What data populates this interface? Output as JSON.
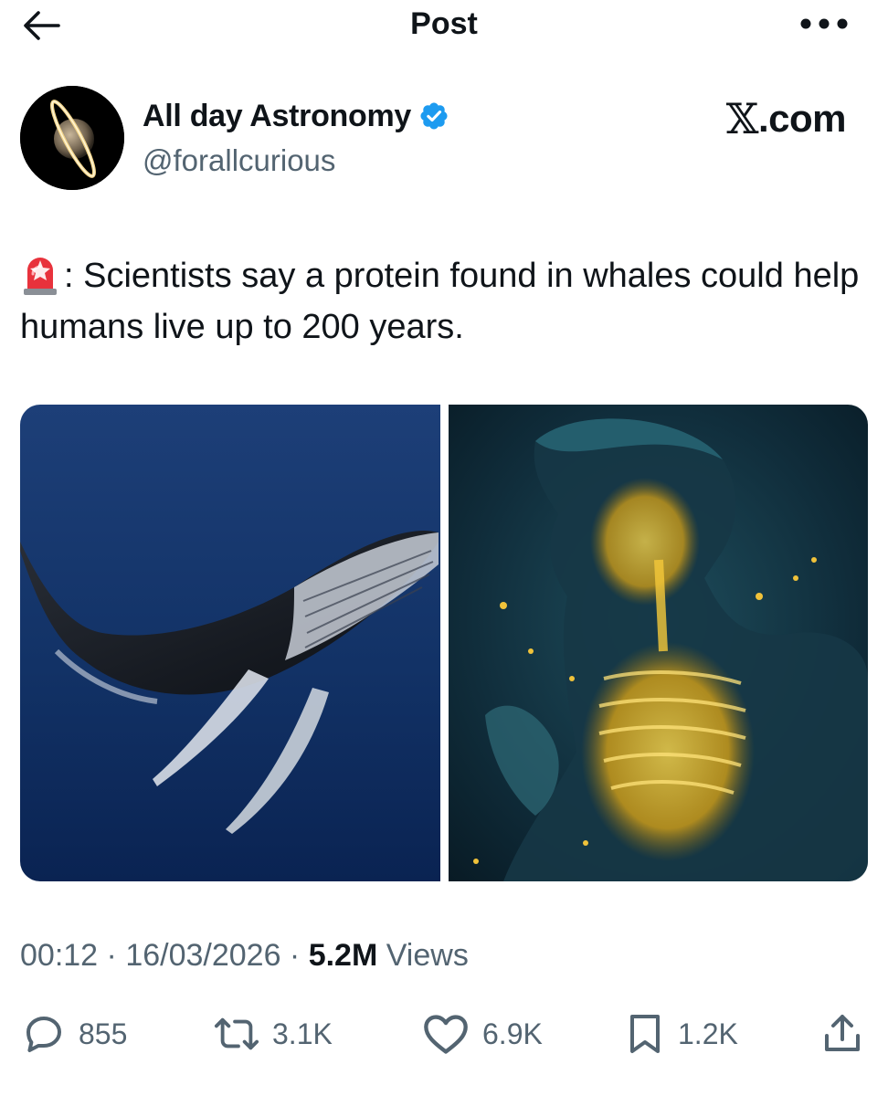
{
  "header": {
    "title": "Post",
    "back_icon": "arrow-left-icon",
    "more_icon": "more-horizontal-icon"
  },
  "author": {
    "name": "All day Astronomy",
    "handle": "@forallcurious",
    "verified": true,
    "badge_color": "#1d9bf0"
  },
  "watermark": {
    "x": "𝕏",
    "rest": ".com"
  },
  "post": {
    "emoji_icon": "siren-icon",
    "text": ": Scientists say a protein found in whales could help humans live up to 200 years."
  },
  "media": [
    {
      "name": "whale-image",
      "subject": "humpback whale"
    },
    {
      "name": "human-glow-image",
      "subject": "man with glowing skeleton"
    }
  ],
  "meta": {
    "time": "00:12",
    "sep1": " · ",
    "date": "16/03/2026",
    "sep2": " · ",
    "views": "5.2M",
    "views_label": " Views"
  },
  "actions": {
    "replies": "855",
    "reposts": "3.1K",
    "likes": "6.9K",
    "bookmarks": "1.2K"
  },
  "colors": {
    "text": "#0f1419",
    "muted": "#536471",
    "accent": "#1d9bf0"
  }
}
